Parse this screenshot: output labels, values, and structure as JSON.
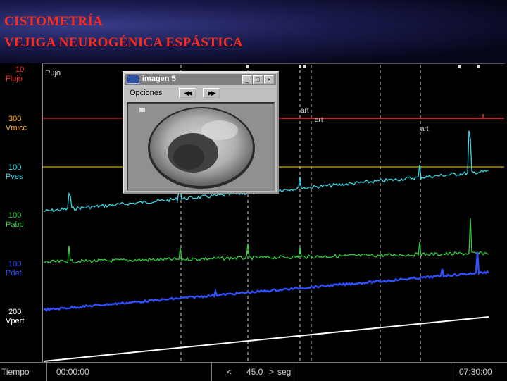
{
  "header": {
    "title_line1": "CISTOMETRÍA",
    "title_line2": "VEJIGA NEUROGÉNICA  ESPÁSTICA"
  },
  "channels": [
    {
      "scale": "10",
      "name": "Flujo",
      "color": "#ff3030"
    },
    {
      "scale": "300",
      "name": "Vmicc",
      "color": "#ffb020"
    },
    {
      "scale": "100",
      "name": "Pves",
      "color": "#3ad8e8"
    },
    {
      "scale": "100",
      "name": "Pabd",
      "color": "#32d040"
    },
    {
      "scale": "100",
      "name": "Pdet",
      "color": "#3050ff"
    },
    {
      "scale": "200",
      "name": "Vperf",
      "color": "#ffffff"
    }
  ],
  "event_label": "Pujo",
  "artifact_labels": [
    "art",
    "art",
    "art"
  ],
  "popup": {
    "title": "imagen 5",
    "menu": "Opciones",
    "prev_label": "◀◀",
    "next_label": "▶▶",
    "btn_min": "_",
    "btn_max": "□",
    "btn_close": "×"
  },
  "statusbar": {
    "axis_label": "Tiempo",
    "start_time": "00:00:00",
    "scroll_left": "<",
    "window": "45.0",
    "scroll_right": ">",
    "unit": "seg",
    "end_time": "07:30:00"
  },
  "colors": {
    "title": "#ff2a1a",
    "pves": "#3ad8e8",
    "pabd": "#32d040",
    "pdet": "#3050ff",
    "vperf": "#ffffff",
    "flujo": "#ff3030",
    "vmicc": "#ffd020"
  }
}
